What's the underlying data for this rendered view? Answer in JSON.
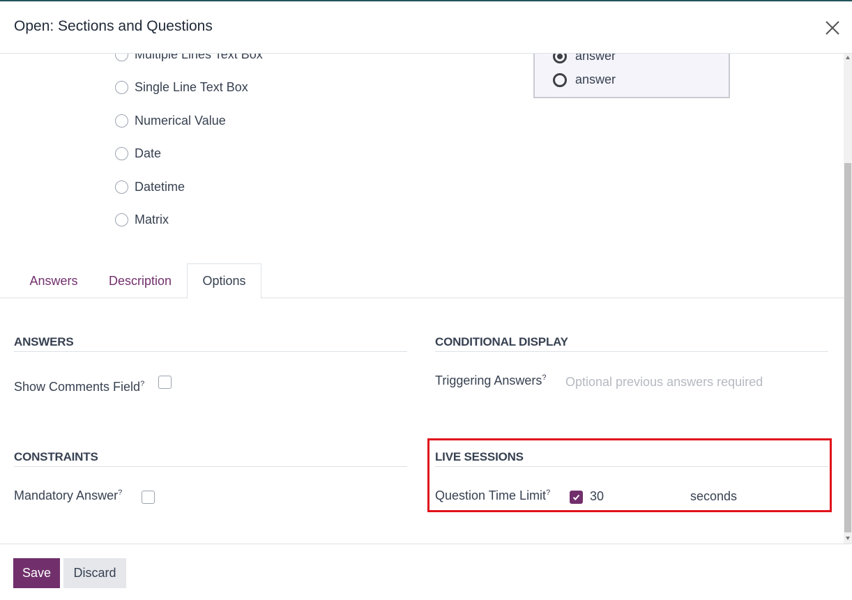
{
  "dialog": {
    "title": "Open: Sections and Questions"
  },
  "question_types": [
    {
      "label": "Multiple Lines Text Box"
    },
    {
      "label": "Single Line Text Box"
    },
    {
      "label": "Numerical Value"
    },
    {
      "label": "Date"
    },
    {
      "label": "Datetime"
    },
    {
      "label": "Matrix"
    }
  ],
  "preview": {
    "options": [
      "answer",
      "answer"
    ]
  },
  "tabs": [
    {
      "label": "Answers",
      "active": false
    },
    {
      "label": "Description",
      "active": false
    },
    {
      "label": "Options",
      "active": true
    }
  ],
  "answers_group": {
    "title": "Answers",
    "show_comments_label": "Show Comments Field",
    "show_comments_checked": false
  },
  "constraints_group": {
    "title": "Constraints",
    "mandatory_label": "Mandatory Answer",
    "mandatory_checked": false
  },
  "conditional_group": {
    "title": "Conditional Display",
    "triggering_label": "Triggering Answers",
    "triggering_placeholder": "Optional previous answers required"
  },
  "live_sessions_group": {
    "title": "Live Sessions",
    "time_limit_label": "Question Time Limit",
    "time_limit_checked": true,
    "time_limit_value": "30",
    "time_limit_unit": "seconds"
  },
  "help_marker": "?",
  "footer": {
    "save_label": "Save",
    "discard_label": "Discard"
  },
  "colors": {
    "primary": "#71306c",
    "highlight": "#e0121b",
    "tab_link": "#71306c"
  }
}
